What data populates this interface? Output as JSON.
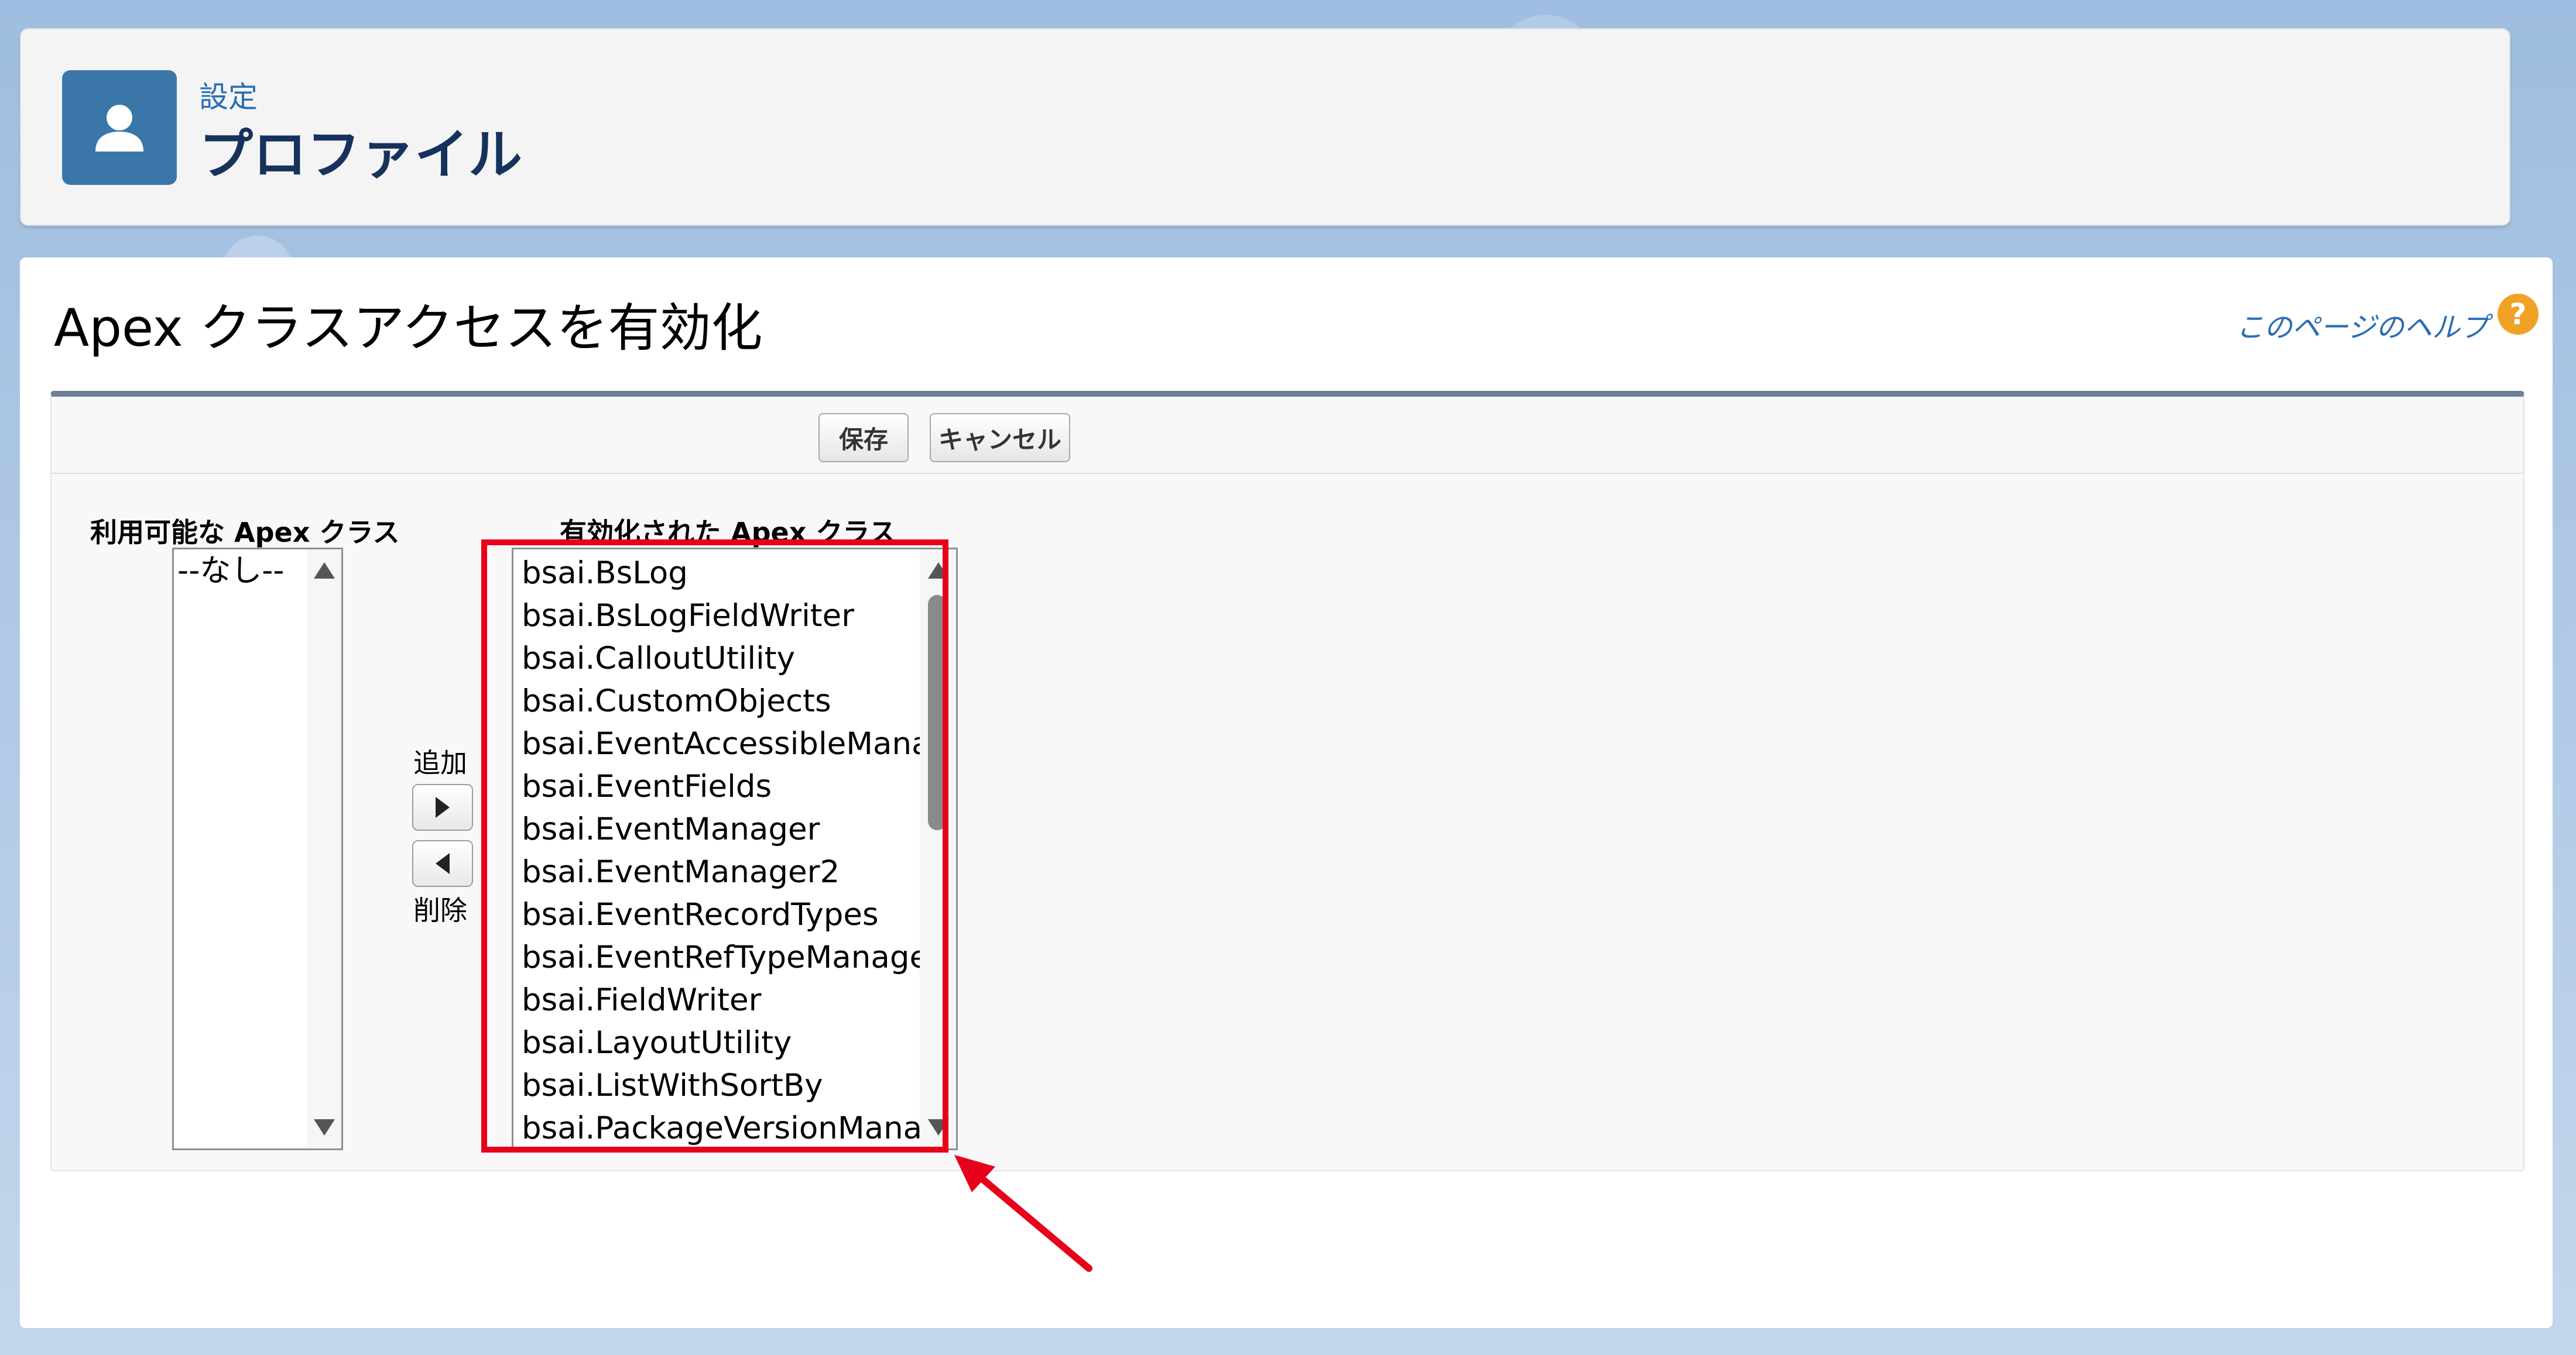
{
  "header": {
    "breadcrumb": "設定",
    "title": "プロファイル"
  },
  "section": {
    "title": "Apex クラスアクセスを有効化",
    "help_link": "このページのヘルプ",
    "help_icon": "?"
  },
  "toolbar": {
    "save_label": "保存",
    "cancel_label": "キャンセル"
  },
  "available": {
    "label": "利用可能な Apex クラス",
    "items": [
      "--なし--"
    ]
  },
  "controls": {
    "add_label": "追加",
    "remove_label": "削除"
  },
  "enabled": {
    "label": "有効化された Apex クラス",
    "items": [
      "bsai.BsLog",
      "bsai.BsLogFieldWriter",
      "bsai.CalloutUtility",
      "bsai.CustomObjects",
      "bsai.EventAccessibleManager",
      "bsai.EventFields",
      "bsai.EventManager",
      "bsai.EventManager2",
      "bsai.EventRecordTypes",
      "bsai.EventRefTypeManager",
      "bsai.FieldWriter",
      "bsai.LayoutUtility",
      "bsai.ListWithSortBy",
      "bsai.PackageVersionManager"
    ]
  },
  "colors": {
    "brand_blue": "#3a77a8",
    "link_blue": "#2a6db5",
    "highlight_red": "#e8001a",
    "help_orange": "#f0a226"
  }
}
